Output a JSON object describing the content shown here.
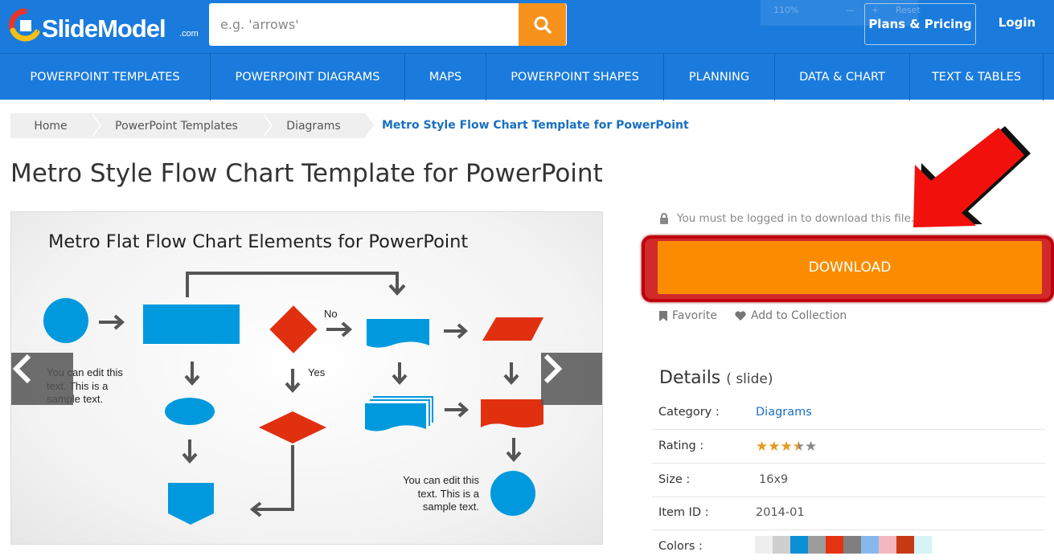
{
  "header": {
    "logo_text": "SlideModel",
    "logo_suffix": ".com",
    "search_placeholder": "e.g. 'arrows'",
    "zoom_level": "110%",
    "zoom_reset": "Reset",
    "plans_label": "Plans & Pricing",
    "login_label": "Login"
  },
  "nav": {
    "items": [
      "POWERPOINT TEMPLATES",
      "POWERPOINT DIAGRAMS",
      "MAPS",
      "POWERPOINT SHAPES",
      "PLANNING",
      "DATA & CHART",
      "TEXT & TABLES"
    ]
  },
  "breadcrumb": {
    "items": [
      "Home",
      "PowerPoint Templates",
      "Diagrams"
    ],
    "current": "Metro Style Flow Chart Template for PowerPoint"
  },
  "page": {
    "title": "Metro Style Flow Chart Template for PowerPoint"
  },
  "preview": {
    "slide_title": "Metro Flat Flow Chart Elements for PowerPoint",
    "note_left": "You can edit this text. This is a sample text.",
    "note_right": "You can edit this text. This is a sample text.",
    "label_no": "No",
    "label_yes": "Yes",
    "colors": {
      "blue": "#0099dd",
      "red": "#e03010",
      "arrow": "#555555"
    }
  },
  "sidebar": {
    "login_note": "You must be logged in to download this file.",
    "download_label": "DOWNLOAD",
    "favorite_label": "Favorite",
    "collection_label": "Add to Collection",
    "details_title": "Details",
    "details_subtitle": "( slide)",
    "category_key": "Category :",
    "category_val": "Diagrams",
    "rating_key": "Rating :",
    "rating_value": 3.5,
    "rating_max": 5,
    "size_key": "Size :",
    "size_val": "16x9",
    "id_key": "Item ID :",
    "id_val": "2014-01",
    "colors_key": "Colors :",
    "swatches": [
      "#eeeeee",
      "#cfcfcf",
      "#0a8fd4",
      "#9c9c9c",
      "#e53312",
      "#7f7f7f",
      "#86b8ec",
      "#f4b6bf",
      "#c63a12",
      "#d6f3f7"
    ]
  },
  "theme": {
    "brand_blue": "#1a7bdc",
    "accent_orange": "#fb8c00",
    "highlight_red": "#c0000e"
  }
}
